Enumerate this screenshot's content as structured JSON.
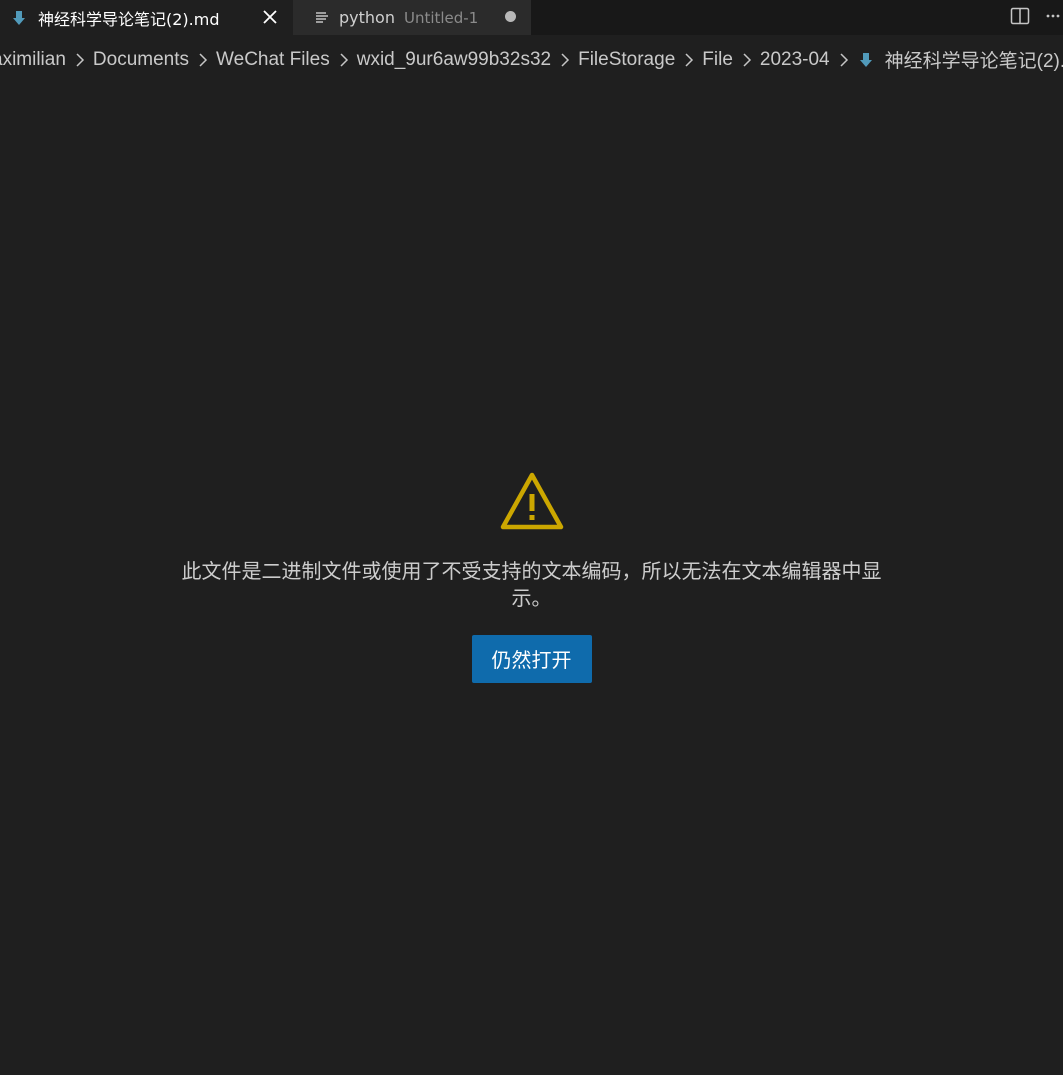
{
  "tabs": [
    {
      "label": "神经科学导论笔记(2).md",
      "icon": "markdown-icon",
      "active": true
    },
    {
      "label": "python",
      "description": "Untitled-1",
      "icon": "file-lines-icon",
      "dirty": true
    }
  ],
  "toolbar": {
    "split_icon": "split-editor-icon",
    "more_icon": "more-actions-icon"
  },
  "breadcrumb": {
    "items": [
      "aximilian",
      "Documents",
      "WeChat Files",
      "wxid_9ur6aw99b32s32",
      "FileStorage",
      "File",
      "2023-04"
    ],
    "current": "神经科学导论笔记(2).m"
  },
  "notice": {
    "icon": "warning-icon",
    "message": "此文件是二进制文件或使用了不受支持的文本编码，所以无法在文本编辑器中显示。",
    "button_label": "仍然打开"
  },
  "colors": {
    "background": "#1f1f1f",
    "tabbar": "#181818",
    "inactive_tab": "#2b2b2b",
    "accent_button": "#0f6bac",
    "warning": "#cca700",
    "markdown_icon": "#519aba"
  }
}
